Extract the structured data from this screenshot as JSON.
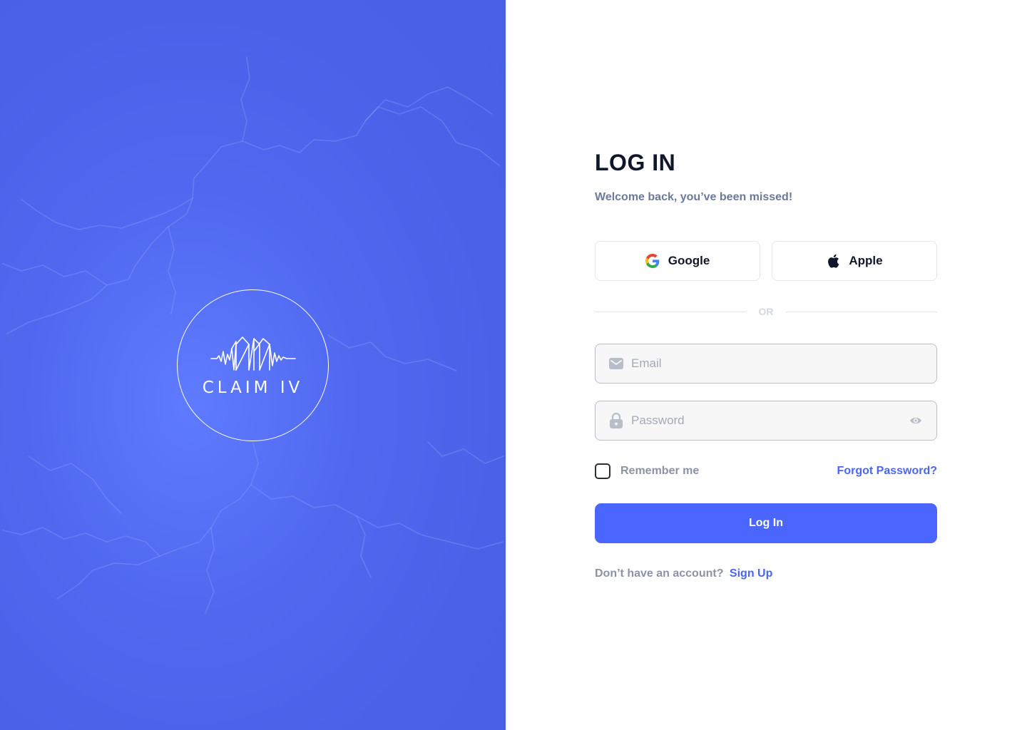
{
  "brand": {
    "logo_text": "CLAIM IV",
    "background_color": "#4a62e8"
  },
  "login": {
    "title": "LOG IN",
    "subtitle": "Welcome back, you’ve been missed!",
    "social": {
      "google_label": "Google",
      "google_icon": "google-icon",
      "apple_label": "Apple",
      "apple_icon": "apple-icon"
    },
    "divider_label": "OR",
    "email": {
      "placeholder": "Email",
      "value": "",
      "icon": "mail-icon"
    },
    "password": {
      "placeholder": "Password",
      "value": "",
      "icon": "lock-icon",
      "toggle_icon": "eye-icon"
    },
    "remember_label": "Remember me",
    "remember_checked": false,
    "forgot_label": "Forgot Password?",
    "submit_label": "Log In",
    "signup_prompt": "Don’t have an account?",
    "signup_link": "Sign Up"
  },
  "colors": {
    "accent": "#4a66ff",
    "link": "#4a66f5",
    "title": "#0f172a",
    "muted": "#8b93a4"
  }
}
